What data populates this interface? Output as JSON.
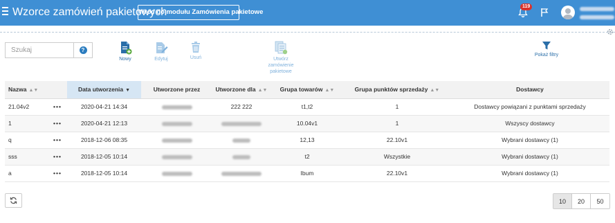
{
  "header": {
    "title": "Wzorce zamówień pakietowych",
    "back_button": "Wróć do modułu Zamówienia pakietowe",
    "notification_count": "119"
  },
  "search": {
    "placeholder": "Szukaj",
    "help_icon": "?"
  },
  "toolbar": {
    "new_label": "Nowy",
    "edit_label": "Edytuj",
    "delete_label": "Usuń",
    "create_label_1": "Utwórz",
    "create_label_2": "zamówienie",
    "create_label_3": "pakietowe",
    "filter_label": "Pokaż filtry"
  },
  "table": {
    "columns": {
      "name": "Nazwa",
      "created_date": "Data utworzenia",
      "created_by": "Utworzone przez",
      "created_for": "Utworzone dla",
      "product_group": "Grupa towarów",
      "pos_group": "Grupa punktów sprzedaży",
      "suppliers": "Dostawcy"
    },
    "sort_icon": "▲▼",
    "sort_desc_icon": "▼",
    "rows": [
      {
        "name": "21.04v2",
        "actions": "•••",
        "date": "2020-04-21 14:34",
        "created_for": "222 222",
        "product_group": "t1,t2",
        "pos_group": "1",
        "suppliers": "Dostawcy powiązani z punktami sprzedaży"
      },
      {
        "name": "1",
        "actions": "•••",
        "date": "2020-04-21 12:13",
        "created_for": "",
        "product_group": "10.04v1",
        "pos_group": "1",
        "suppliers": "Wszyscy dostawcy"
      },
      {
        "name": "q",
        "actions": "•••",
        "date": "2018-12-06 08:35",
        "created_for": "",
        "product_group": "12,13",
        "pos_group": "22.10v1",
        "suppliers": "Wybrani dostawcy (1)"
      },
      {
        "name": "sss",
        "actions": "•••",
        "date": "2018-12-05 10:14",
        "created_for": "",
        "product_group": "t2",
        "pos_group": "Wszystkie",
        "suppliers": "Wybrani dostawcy (1)"
      },
      {
        "name": "a",
        "actions": "•••",
        "date": "2018-12-05 10:14",
        "created_for": "",
        "product_group": "Ibum",
        "pos_group": "22.10v1",
        "suppliers": "Wybrani dostawcy (1)"
      }
    ]
  },
  "pagination": {
    "sizes": [
      "10",
      "20",
      "50"
    ],
    "selected": "10"
  },
  "colors": {
    "topbar": "#3f8fd4",
    "accent": "#2a7cbf",
    "sorted_header": "#d6e6f4"
  }
}
